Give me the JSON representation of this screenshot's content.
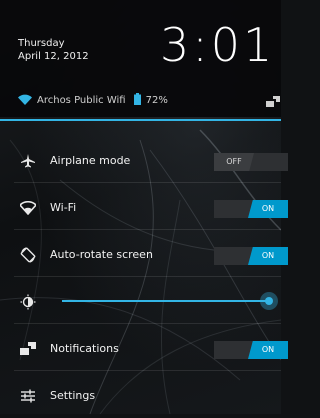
{
  "header": {
    "day": "Thursday",
    "date": "April 12, 2012",
    "time": "3:01",
    "wifi_name": "Archos Public Wifi",
    "battery": "72%"
  },
  "settings": {
    "airplane": {
      "label": "Airplane mode",
      "state": "OFF"
    },
    "wifi": {
      "label": "Wi-Fi",
      "state": "ON"
    },
    "autorotate": {
      "label": "Auto-rotate screen",
      "state": "ON"
    },
    "brightness": {
      "level": 1.0
    },
    "notifications": {
      "label": "Notifications",
      "state": "ON"
    },
    "settings": {
      "label": "Settings"
    }
  },
  "colors": {
    "accent": "#33b5e5",
    "toggle_on": "#0099cc",
    "header_bg": "#08080a"
  },
  "icons": [
    "wifi-icon",
    "battery-icon",
    "notifications-icon",
    "airplane-icon",
    "wifi-icon",
    "autorotate-icon",
    "brightness-icon",
    "notifications-icon",
    "settings-icon"
  ]
}
